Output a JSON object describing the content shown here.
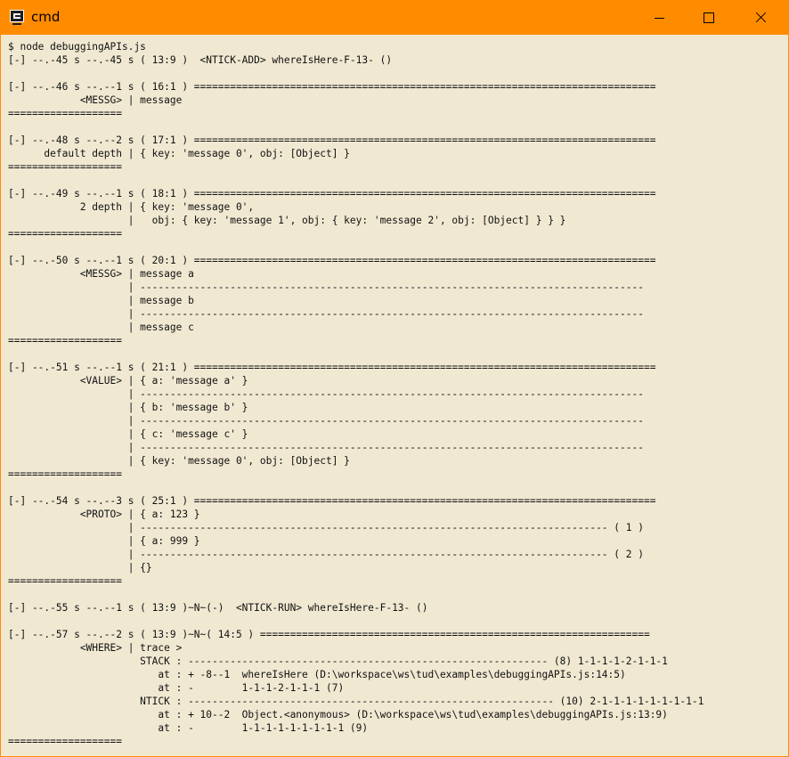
{
  "window": {
    "title": "cmd",
    "controls": {
      "minimize": "minimize",
      "maximize": "maximize",
      "close": "close"
    }
  },
  "console": {
    "lines": [
      "$ node debuggingAPIs.js",
      "[-] --.-45 s --.-45 s ( 13:9 )  <NTICK-ADD> whereIsHere-F-13- ()",
      "",
      "[-] --.-46 s --.--1 s ( 16:1 ) =============================================================================",
      "            <MESSG> | message",
      "===================",
      "",
      "[-] --.-48 s --.--2 s ( 17:1 ) =============================================================================",
      "      default depth | { key: 'message 0', obj: [Object] }",
      "===================",
      "",
      "[-] --.-49 s --.--1 s ( 18:1 ) =============================================================================",
      "            2 depth | { key: 'message 0',",
      "                    |   obj: { key: 'message 1', obj: { key: 'message 2', obj: [Object] } } }",
      "===================",
      "",
      "[-] --.-50 s --.--1 s ( 20:1 ) =============================================================================",
      "            <MESSG> | message a",
      "                    | ------------------------------------------------------------------------------------",
      "                    | message b",
      "                    | ------------------------------------------------------------------------------------",
      "                    | message c",
      "===================",
      "",
      "[-] --.-51 s --.--1 s ( 21:1 ) =============================================================================",
      "            <VALUE> | { a: 'message a' }",
      "                    | ------------------------------------------------------------------------------------",
      "                    | { b: 'message b' }",
      "                    | ------------------------------------------------------------------------------------",
      "                    | { c: 'message c' }",
      "                    | ------------------------------------------------------------------------------------",
      "                    | { key: 'message 0', obj: [Object] }",
      "===================",
      "",
      "[-] --.-54 s --.--3 s ( 25:1 ) =============================================================================",
      "            <PROTO> | { a: 123 }",
      "                    | ------------------------------------------------------------------------------ ( 1 )",
      "                    | { a: 999 }",
      "                    | ------------------------------------------------------------------------------ ( 2 )",
      "                    | {}",
      "===================",
      "",
      "[-] --.-55 s --.--1 s ( 13:9 )~N~(-)  <NTICK-RUN> whereIsHere-F-13- ()",
      "",
      "[-] --.-57 s --.--2 s ( 13:9 )~N~( 14:5 ) =================================================================",
      "            <WHERE> | trace >",
      "                      STACK : ------------------------------------------------------------ (8) 1-1-1-1-2-1-1-1",
      "                         at : + -8--1  whereIsHere (D:\\workspace\\ws\\tud\\examples\\debuggingAPIs.js:14:5)",
      "                         at : -        1-1-1-2-1-1-1 (7)",
      "                      NTICK : ------------------------------------------------------------- (10) 2-1-1-1-1-1-1-1-1-1",
      "                         at : + 10--2  Object.<anonymous> (D:\\workspace\\ws\\tud\\examples\\debuggingAPIs.js:13:9)",
      "                         at : -        1-1-1-1-1-1-1-1-1 (9)",
      "==================="
    ]
  }
}
